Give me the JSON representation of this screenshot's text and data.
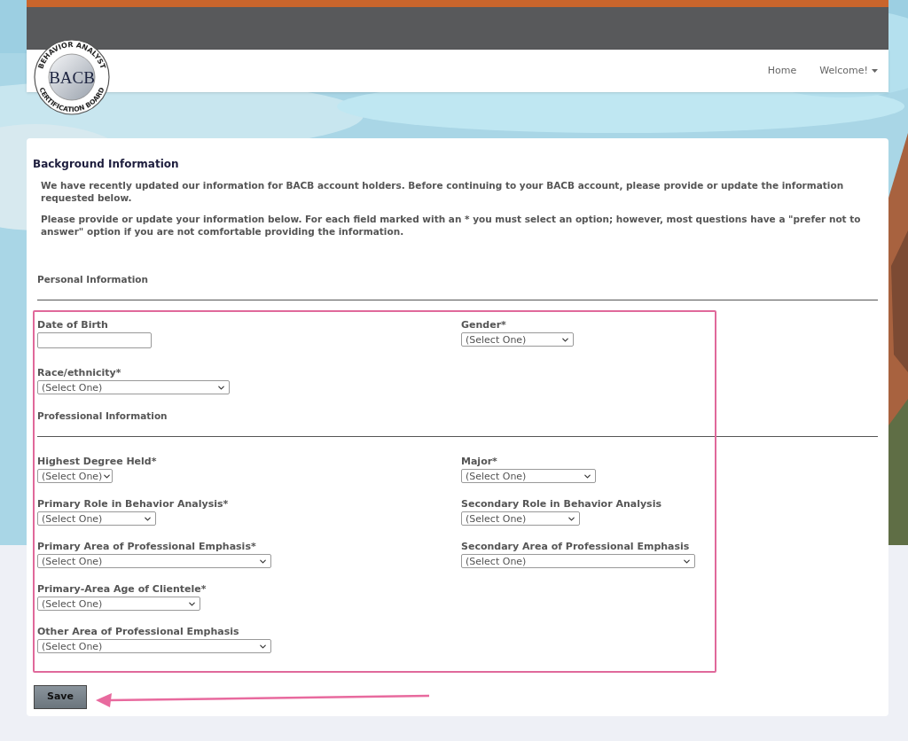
{
  "logo": {
    "initials": "BACB",
    "ring_top": "BEHAVIOR ANALYST",
    "ring_bottom": "CERTIFICATION BOARD"
  },
  "nav": {
    "items": [
      {
        "label": "Home",
        "dropdown": false
      },
      {
        "label": "Welcome!",
        "dropdown": true
      }
    ]
  },
  "form": {
    "title": "Background Information",
    "paragraphs": [
      "We have recently updated our information for BACB account holders. Before continuing to your BACB account, please provide or update the information requested below.",
      "Please provide or update your information below. For each field marked with an * you must select an option; however, most questions have a \"prefer not to answer\" option if you are not comfortable providing the information."
    ],
    "sections": [
      {
        "heading": "Personal Information",
        "rows": [
          {
            "left": {
              "label": "Date of Birth",
              "kind": "text"
            },
            "right": {
              "label": "Gender*",
              "kind": "select",
              "value": "(Select One)"
            }
          },
          {
            "left": {
              "label": "Race/ethnicity*",
              "kind": "select",
              "value": "(Select One)"
            }
          }
        ]
      },
      {
        "heading": "Professional Information",
        "rows": [
          {
            "left": {
              "label": "Highest Degree Held*",
              "kind": "select",
              "value": "(Select One)"
            },
            "right": {
              "label": "Major*",
              "kind": "select",
              "value": "(Select One)"
            }
          },
          {
            "left": {
              "label": "Primary Role in Behavior Analysis*",
              "kind": "select",
              "value": "(Select One)"
            },
            "right": {
              "label": "Secondary Role in Behavior Analysis",
              "kind": "select",
              "value": "(Select One)"
            }
          },
          {
            "left": {
              "label": "Primary Area of Professional Emphasis*",
              "kind": "select",
              "value": "(Select One)"
            },
            "right": {
              "label": "Secondary Area of Professional Emphasis",
              "kind": "select",
              "value": "(Select One)"
            }
          },
          {
            "left": {
              "label": "Primary-Area Age of Clientele*",
              "kind": "select",
              "value": "(Select One)"
            }
          },
          {
            "left": {
              "label": "Other Area of Professional Emphasis",
              "kind": "select",
              "value": "(Select One)"
            }
          }
        ]
      }
    ],
    "save": "Save"
  }
}
